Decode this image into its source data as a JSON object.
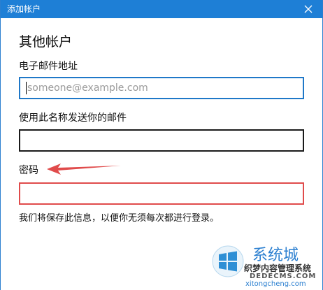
{
  "window": {
    "title": "添加帐户",
    "close_icon": "close-icon"
  },
  "form": {
    "heading": "其他帐户",
    "email_label": "电子邮件地址",
    "email_placeholder": "someone@example.com",
    "email_value": "",
    "name_label": "使用此名称发送你的邮件",
    "name_value": "",
    "password_label": "密码",
    "password_value": "",
    "note": "我们将保存此信息，以便你无须每次都进行登录。"
  },
  "annotation": {
    "arrow_color": "#e04b4b"
  },
  "watermark": {
    "brand": "系统城",
    "line1": "织梦内容管理系统",
    "line2": "DEDECMS.COM",
    "line3": "xitongcheng.com"
  },
  "colors": {
    "titlebar": "#1e7fd6",
    "focus_border": "#1f78c8",
    "highlight_border": "#e04b4b"
  }
}
